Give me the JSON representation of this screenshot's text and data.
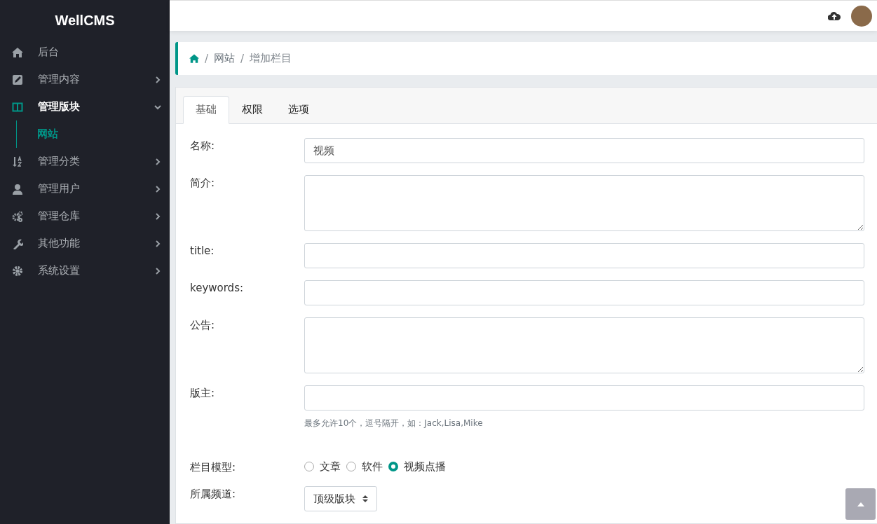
{
  "sidebar": {
    "brand": "WellCMS",
    "items": [
      {
        "label": "后台",
        "kind": "link",
        "selected": false
      },
      {
        "label": "管理内容",
        "kind": "group",
        "selected": false,
        "expanded": false
      },
      {
        "label": "管理版块",
        "kind": "group",
        "selected": true,
        "expanded": true,
        "children": [
          {
            "label": "网站",
            "selected": true
          }
        ]
      },
      {
        "label": "管理分类",
        "kind": "group",
        "selected": false,
        "expanded": false
      },
      {
        "label": "管理用户",
        "kind": "group",
        "selected": false,
        "expanded": false
      },
      {
        "label": "管理仓库",
        "kind": "group",
        "selected": false,
        "expanded": false
      },
      {
        "label": "其他功能",
        "kind": "group",
        "selected": false,
        "expanded": false
      },
      {
        "label": "系统设置",
        "kind": "group",
        "selected": false,
        "expanded": false
      }
    ]
  },
  "breadcrumb": [
    {
      "kind": "separator",
      "text": "/"
    },
    {
      "kind": "link",
      "text": "网站"
    },
    {
      "kind": "separator",
      "text": "/"
    },
    {
      "kind": "current",
      "text": "增加栏目"
    }
  ],
  "tabs": [
    {
      "label": "基础",
      "selected": true
    },
    {
      "label": "权限",
      "selected": false
    },
    {
      "label": "选项",
      "selected": false
    }
  ],
  "form": [
    {
      "kind": "text",
      "label": "名称:",
      "value": "视频"
    },
    {
      "kind": "textarea",
      "label": "简介:"
    },
    {
      "kind": "text",
      "label": "title:"
    },
    {
      "kind": "text",
      "label": "keywords:"
    },
    {
      "kind": "textarea",
      "label": "公告:"
    },
    {
      "kind": "text",
      "label": "版主:",
      "hint": "最多允许10个，逗号隔开，如：Jack,Lisa,Mike"
    },
    {
      "kind": "radio",
      "label": "栏目模型:",
      "options": [
        {
          "label": "文章",
          "selected": false
        },
        {
          "label": "软件",
          "selected": false
        },
        {
          "label": "视频点播",
          "selected": true
        }
      ]
    },
    {
      "kind": "select",
      "label": "所属频道:",
      "value": "顶级版块"
    }
  ]
}
